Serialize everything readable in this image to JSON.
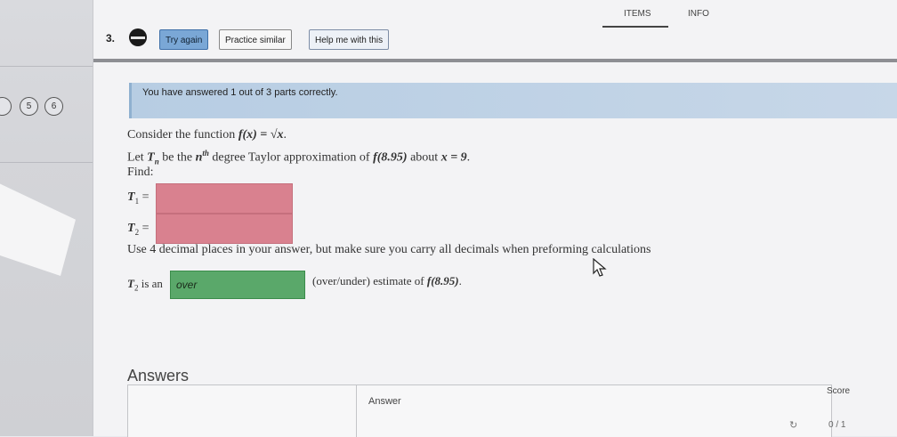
{
  "nav": {
    "items_tab": "ITEMS",
    "info_tab": "INFO"
  },
  "left": {
    "page_numbers": [
      "5",
      "6"
    ]
  },
  "question": {
    "number": "3.",
    "buttons": {
      "try_again": "Try again",
      "practice_similar": "Practice similar",
      "help": "Help me with this"
    }
  },
  "banner": {
    "text": "You have answered 1 out of 3 parts correctly."
  },
  "problem": {
    "line1": {
      "prefix": "Consider the function ",
      "math": "f(x) = √x",
      "suffix": "."
    },
    "line2": {
      "prefix": "Let ",
      "math1": "T",
      "sub1": "n",
      "mid1": " be the ",
      "math2": "n",
      "sup2": "th",
      "mid2": " degree Taylor approximation of ",
      "math3": "f(8.95)",
      "mid3": " about ",
      "math4": "x = 9",
      "suffix": "."
    },
    "find": "Find:",
    "t1_label": "T",
    "t1_sub": "1",
    "t2_label": "T",
    "t2_sub": "2",
    "eq": " =",
    "instruction": "Use 4 decimal places in your answer, but make sure you carry all decimals when preforming calculations",
    "estimate_prefix_math": "T",
    "estimate_prefix_sub": "2",
    "estimate_prefix_text": " is an",
    "estimate_value": "over",
    "estimate_suffix_text": "(over/under) estimate of ",
    "estimate_suffix_math": "f(8.95)",
    "estimate_suffix_end": "."
  },
  "answers": {
    "title": "Answers",
    "column_answer": "Answer",
    "column_score": "Score",
    "score_value": "0 / 1"
  },
  "colors": {
    "incorrect": "#d9818f",
    "correct": "#5aa86a",
    "banner": "#b7cde3",
    "try_button": "#7aa7d6"
  }
}
